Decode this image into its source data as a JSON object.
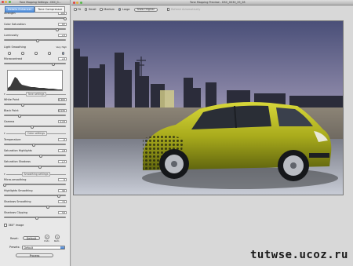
{
  "left_panel": {
    "window_title": "Tone Mapping Settings - DSC_0...",
    "tabs": [
      "Details Enhancer",
      "Tone Compressor"
    ],
    "active_tab": "Details Enhancer",
    "controls": {
      "strength": {
        "label": "Strength",
        "value": "100",
        "level": 1.0
      },
      "color_saturation": {
        "label": "Color Saturation",
        "value": "87",
        "level": 0.87
      },
      "luminosity": {
        "label": "Luminosity",
        "value": "+5",
        "level": 0.55
      },
      "light_smoothing": {
        "label": "Light Smoothing",
        "value": "Very High",
        "selected_index": 4
      },
      "microcontrast": {
        "label": "Microcontrast",
        "value": "+6",
        "level": 0.8
      }
    },
    "sections": {
      "tone": "Tone settings",
      "color": "Color settings",
      "smoothing": "Smoothing settings"
    },
    "tone": {
      "white_point": {
        "label": "White Point",
        "value": "2.400",
        "level": 0.3
      },
      "black_point": {
        "label": "Black Point",
        "value": "0.535",
        "level": 0.25
      },
      "gamma": {
        "label": "Gamma",
        "value": "1.23",
        "level": 0.45
      }
    },
    "color": {
      "temperature": {
        "label": "Temperature",
        "value": "-2",
        "level": 0.48
      },
      "saturation_highlights": {
        "label": "Saturation Highlights",
        "value": "+8",
        "level": 0.6
      },
      "saturation_shadows": {
        "label": "Saturation Shadows",
        "value": "+7",
        "level": 0.58
      }
    },
    "smoothing": {
      "micro_smoothing": {
        "label": "Micro-smoothing",
        "value": "0",
        "level": 0.0
      },
      "highlights_smoothing": {
        "label": "Highlights Smoothing",
        "value": "90",
        "level": 0.9
      },
      "shadows_smoothing": {
        "label": "Shadows Smoothing",
        "value": "71",
        "level": 0.71
      },
      "shadows_clipping": {
        "label": "Shadows Clipping",
        "value": "53",
        "level": 0.53
      }
    },
    "check_360": "360° image",
    "reset_label": "Reset:",
    "default_button": "Default",
    "undo_label": "Undo",
    "redo_label": "Redo",
    "presets_label": "Presets:",
    "presets_value": "Default",
    "process_button": "Process"
  },
  "preview_window": {
    "title": "Tone Mapping Preview - DSC_0030_29_28",
    "zoom_options": [
      "Fit",
      "Small",
      "Medium",
      "Large"
    ],
    "zoom_selected": "Large",
    "show_original_button": "Show Original",
    "refresh_checkbox": "Refresh Automatically"
  },
  "watermark": "tutwse.ucoz.ru",
  "colors": {
    "accent_blue": "#4f8fdc",
    "car_body": "#b6b722"
  }
}
